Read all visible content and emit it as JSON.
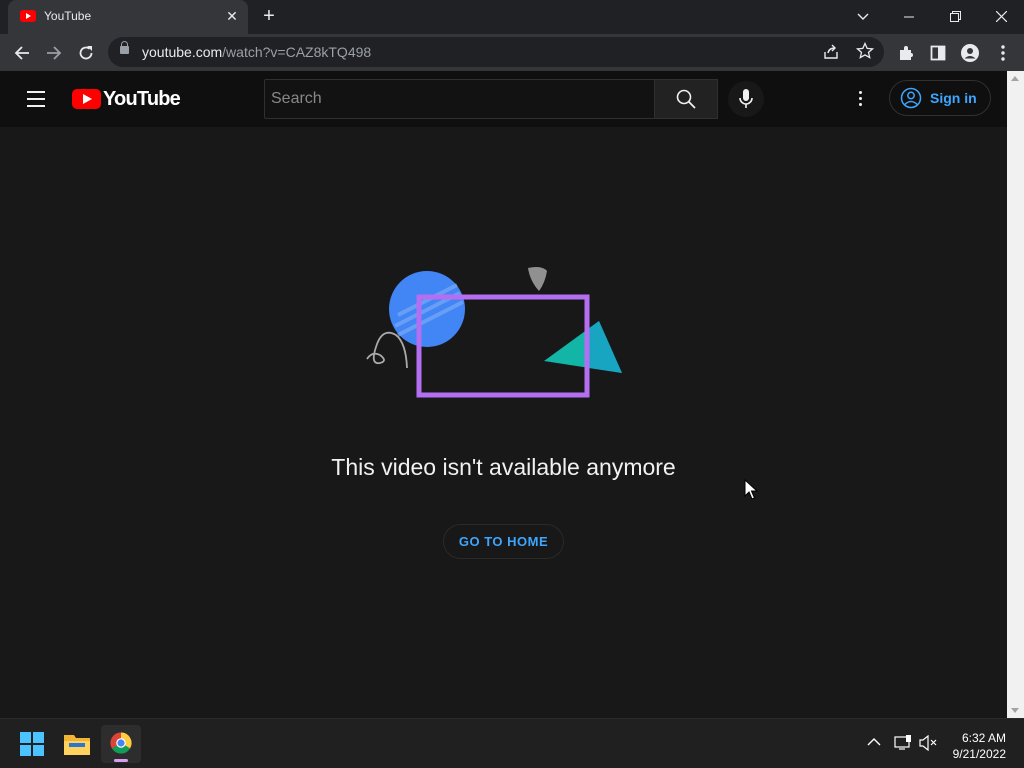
{
  "browser": {
    "tab_title": "YouTube",
    "tab_close": "✕",
    "new_tab": "+",
    "url_host": "youtube.com",
    "url_path": "/watch?v=CAZ8kTQ498",
    "window_controls": {
      "dropdown": "⌄",
      "minimize": "—",
      "restore": "❐",
      "close": "✕"
    }
  },
  "youtube": {
    "logo_text": "YouTube",
    "search_placeholder": "Search",
    "sign_in_label": "Sign in",
    "error_message": "This video isn't available anymore",
    "go_home_label": "GO TO HOME"
  },
  "taskbar": {
    "time": "6:32 AM",
    "date": "9/21/2022"
  },
  "colors": {
    "youtube_red": "#ff0000",
    "link_blue": "#3ea6ff",
    "illus_circle": "#4285f4",
    "illus_rect": "#b46ef2",
    "illus_triangle": "#12b5a6"
  }
}
